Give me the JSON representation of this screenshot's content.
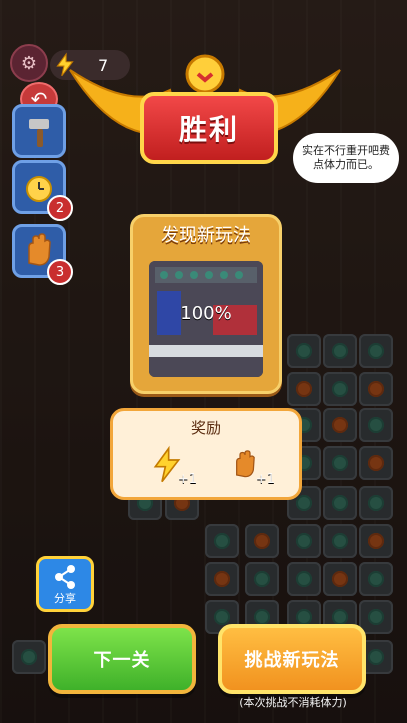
{
  "hud": {
    "energy_value": "7",
    "tool_badges": [
      "2",
      "3"
    ]
  },
  "speech_bubble": "实在不行重开吧费点体力而已。",
  "victory": {
    "title": "胜利"
  },
  "new_play": {
    "title": "发现新玩法",
    "progress_text": "100%"
  },
  "reward": {
    "title": "奖励",
    "items": [
      {
        "icon": "energy-bolt-icon",
        "amount": "+1"
      },
      {
        "icon": "glove-icon",
        "amount": "+1"
      }
    ]
  },
  "share": {
    "label": "分享"
  },
  "buttons": {
    "next": "下一关",
    "challenge": "挑战新玩法"
  },
  "note": "(本次挑战不消耗体力)",
  "colors": {
    "victory_banner": "#d52a2a",
    "accent_gold": "#f7d06a",
    "next_button": "#57c835",
    "challenge_button": "#f4a12a",
    "share_button": "#2d88e6"
  }
}
